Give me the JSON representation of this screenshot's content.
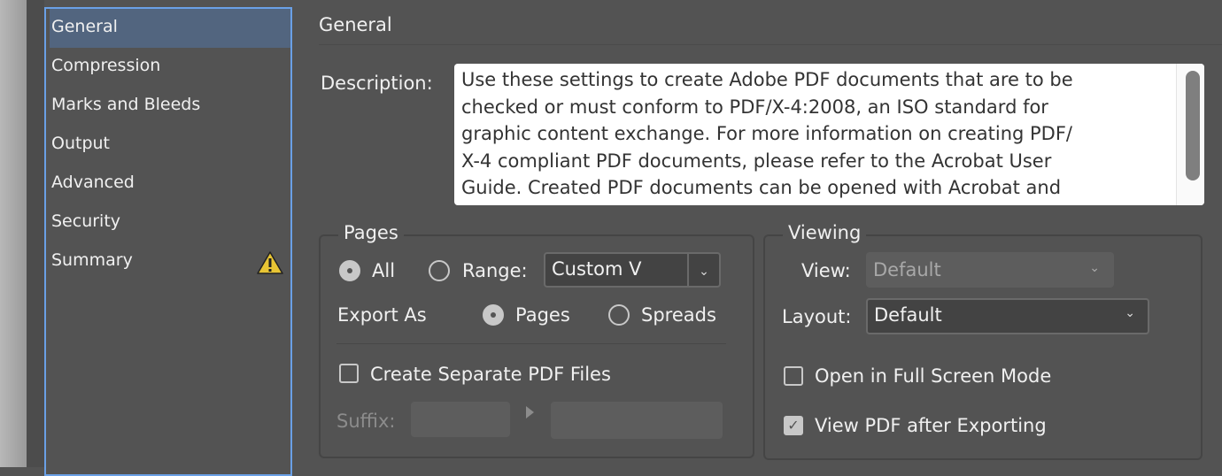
{
  "sidebar": {
    "items": [
      {
        "label": "General",
        "selected": true
      },
      {
        "label": "Compression"
      },
      {
        "label": "Marks and Bleeds"
      },
      {
        "label": "Output"
      },
      {
        "label": "Advanced"
      },
      {
        "label": "Security"
      },
      {
        "label": "Summary",
        "icon": "warning-icon"
      }
    ]
  },
  "main": {
    "title": "General",
    "description_label": "Description:",
    "description": "Use these settings to create Adobe PDF documents that are to be\nchecked or must conform to PDF/X-4:2008, an ISO standard for\ngraphic content exchange.  For more information on creating PDF/\nX-4 compliant PDF documents, please refer to the Acrobat User\nGuide.  Created PDF documents can be opened with Acrobat and"
  },
  "pages": {
    "legend": "Pages",
    "all_label": "All",
    "range_label": "Range:",
    "range_value": "Custom V",
    "export_as_label": "Export As",
    "pages_label": "Pages",
    "spreads_label": "Spreads",
    "separate_label": "Create Separate PDF Files",
    "suffix_label": "Suffix:",
    "suffix_value": "",
    "all_selected": true,
    "export_pages_selected": true,
    "separate_checked": false
  },
  "viewing": {
    "legend": "Viewing",
    "view_label": "View:",
    "view_value": "Default",
    "layout_label": "Layout:",
    "layout_value": "Default",
    "fullscreen_label": "Open in Full Screen Mode",
    "fullscreen_checked": false,
    "view_after_label": "View PDF after Exporting",
    "view_after_checked": true
  },
  "colors": {
    "accent": "#6aa0e6",
    "selected_row": "#52657f",
    "warning": "#e8c534"
  }
}
